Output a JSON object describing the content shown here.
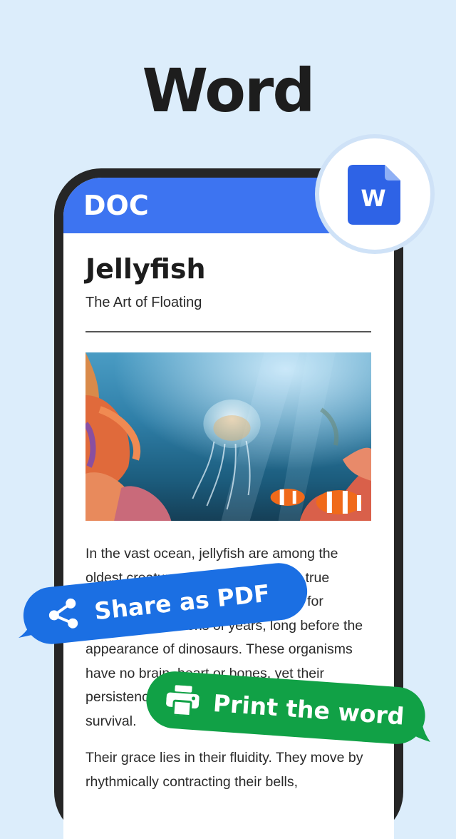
{
  "headline": "Word",
  "doc": {
    "header_label": "DOC",
    "title": "Jellyfish",
    "subtitle": "The Art of Floating",
    "paragraph1": "In the vast ocean, jellyfish are among the oldest creatures on earth. They are true survivors, having drifted in the seas for hundreds of millions of years, long before the appearance of dinosaurs. These organisms have no brain, heart or bones, yet their persistence has made them masters of survival.",
    "paragraph2": "Their grace lies in their fluidity. They move by rhythmically contracting their bells,",
    "image_alt": "Jellyfish floating above coral reef with clownfish"
  },
  "badge": {
    "letter": "W",
    "icon": "word-document-icon"
  },
  "actions": {
    "share_label": "Share as PDF",
    "share_icon": "share-icon",
    "print_label": "Print the word",
    "print_icon": "printer-icon"
  },
  "colors": {
    "background": "#dcedfb",
    "doc_header": "#3d74f1",
    "share_bubble": "#1b6fe3",
    "print_bubble": "#11a146",
    "phone_frame": "#262626"
  }
}
